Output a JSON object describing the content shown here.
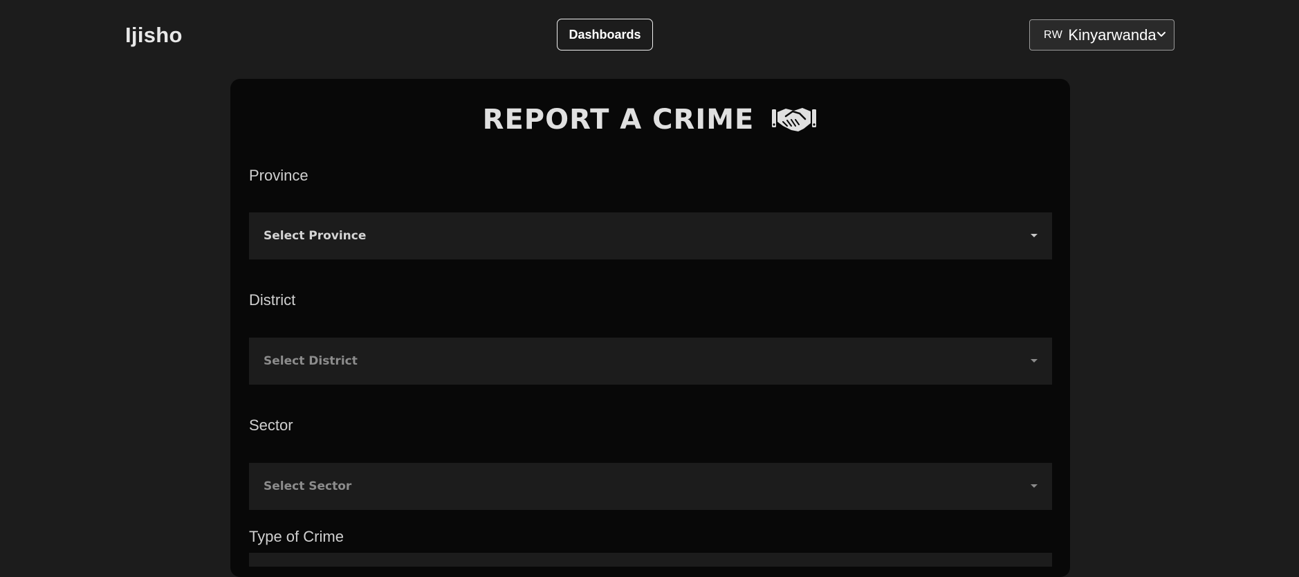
{
  "nav": {
    "brand": "Ijisho",
    "dashboards_label": "Dashboards",
    "language": {
      "code": "RW",
      "label": "Kinyarwanda"
    }
  },
  "form": {
    "title": "REPORT A CRIME",
    "title_icon": "handshake-icon",
    "fields": [
      {
        "label": "Province",
        "placeholder": "Select Province"
      },
      {
        "label": "District",
        "placeholder": "Select District"
      },
      {
        "label": "Sector",
        "placeholder": "Select Sector"
      },
      {
        "label": "Type of Crime"
      }
    ]
  }
}
